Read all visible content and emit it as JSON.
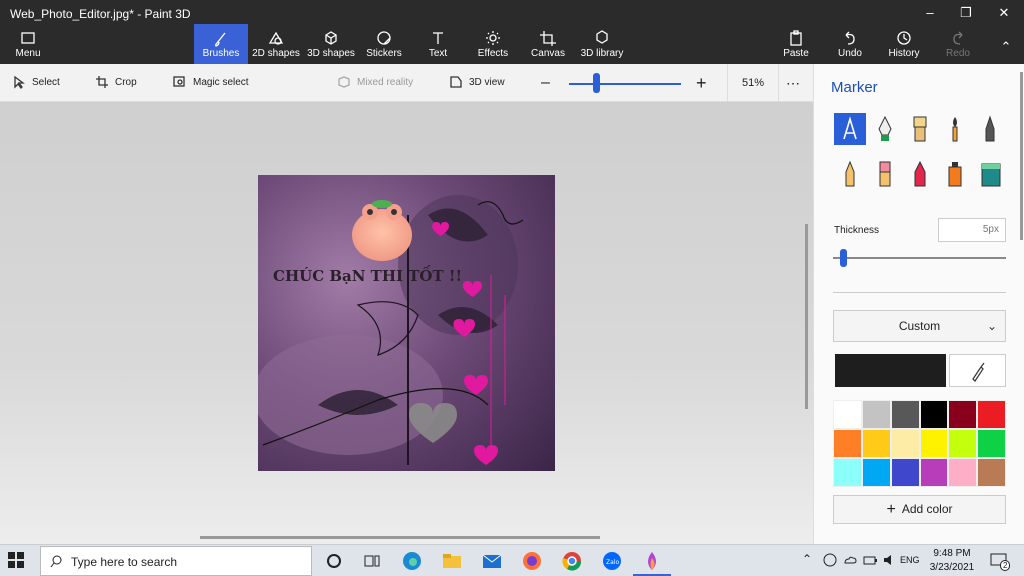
{
  "window": {
    "title": "Web_Photo_Editor.jpg* - Paint 3D",
    "controls": [
      "minimize",
      "restore",
      "close"
    ]
  },
  "ribbon": {
    "menu_label": "Menu",
    "tools": [
      {
        "label": "Brushes",
        "icon": "brush-icon",
        "active": true
      },
      {
        "label": "2D shapes",
        "icon": "2d-shapes-icon"
      },
      {
        "label": "3D shapes",
        "icon": "3d-shapes-icon"
      },
      {
        "label": "Stickers",
        "icon": "stickers-icon"
      },
      {
        "label": "Text",
        "icon": "text-icon"
      },
      {
        "label": "Effects",
        "icon": "effects-icon"
      },
      {
        "label": "Canvas",
        "icon": "canvas-icon"
      },
      {
        "label": "3D library",
        "icon": "3d-library-icon"
      }
    ],
    "paste_label": "Paste",
    "undo_label": "Undo",
    "history_label": "History",
    "redo_label": "Redo"
  },
  "toolbar": {
    "select_label": "Select",
    "crop_label": "Crop",
    "magic_select_label": "Magic select",
    "mixed_reality_label": "Mixed reality",
    "view3d_label": "3D view",
    "zoom_value": "51%",
    "more_label": "⋯"
  },
  "canvas": {
    "image_text": "CHÚC BạN THI TỐT !!"
  },
  "panel": {
    "title": "Marker",
    "brushes": [
      "marker",
      "calligraphy-pen",
      "oil-brush",
      "watercolor",
      "pixel-pen",
      "pencil",
      "eraser",
      "crayon",
      "spray-can",
      "fill-bucket"
    ],
    "thickness_label": "Thickness",
    "thickness_value": "5px",
    "color_mode": "Custom",
    "current_color": "#1e1e1e",
    "palette": [
      "#ffffff",
      "#c3c3c3",
      "#585858",
      "#000000",
      "#88001b",
      "#ec1c24",
      "#ff7f27",
      "#ffca18",
      "#fdeca6",
      "#fff200",
      "#c4ff0e",
      "#0ed145",
      "#8cfffb",
      "#00a8f3",
      "#3f48cc",
      "#b83dba",
      "#ffaec8",
      "#b97a56"
    ],
    "add_color_label": "Add color"
  },
  "taskbar": {
    "search_placeholder": "Type here to search",
    "time": "9:48 PM",
    "date": "3/23/2021",
    "language": "ENG",
    "notification_count": "2"
  }
}
